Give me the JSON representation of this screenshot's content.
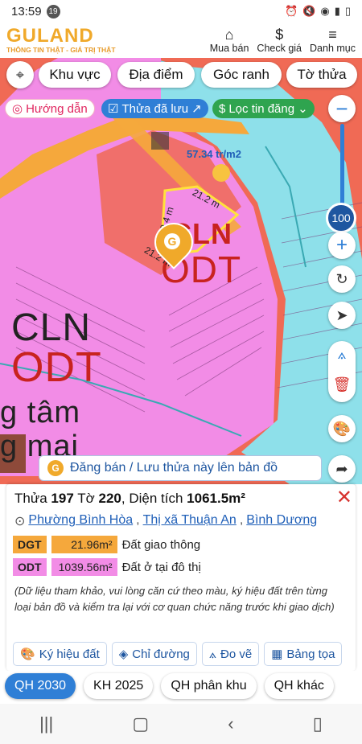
{
  "status": {
    "time": "13:59",
    "badge": "19",
    "icons": [
      "alarm-icon",
      "mute-icon",
      "wifi-icon",
      "signal-icon",
      "battery-icon"
    ]
  },
  "header": {
    "logo": "GULAND",
    "tagline": "THÔNG TIN THẬT - GIÁ TRỊ THẬT",
    "actions": [
      {
        "label": "Mua bán"
      },
      {
        "label": "Check giá"
      },
      {
        "label": "Danh mục"
      }
    ]
  },
  "filters": {
    "khu_vuc": "Khu vực",
    "dia_diem": "Địa điểm",
    "goc_ranh": "Góc ranh",
    "to_thua": "Tờ thửa"
  },
  "pills": {
    "huong_dan": "Hướng dẫn",
    "thua_da_luu": "Thửa đã lưu",
    "loc_tin": "Lọc tin đăng"
  },
  "map": {
    "price": "57.34 tr/m2",
    "dims": [
      "21.2 m",
      "50.4 m",
      "21.2 m"
    ],
    "labels": [
      {
        "t1": "CLN",
        "t2": "ODT"
      },
      {
        "t1": "CLN",
        "t2": "ODT"
      }
    ],
    "street_text": [
      "g tâm",
      "g mại"
    ],
    "zoom": "100",
    "colors": {
      "bg": "#f06a55",
      "pink": "#f28ce6",
      "road": "#f5a83c",
      "water": "#8ee0ea"
    }
  },
  "banner": {
    "text": "Đăng bán / Lưu thửa này lên bản đồ"
  },
  "parcel": {
    "thua_label": "Thửa",
    "thua": "197",
    "to_label": "Tờ",
    "to": "220",
    "area_label": "Diện tích",
    "area": "1061.5m²",
    "ward": "Phường Bình Hòa",
    "district": "Thị xã Thuận An",
    "province": "Bình Dương",
    "land": [
      {
        "code": "DGT",
        "area": "21.96m²",
        "name": "Đất giao thông",
        "color": "#f5a83c"
      },
      {
        "code": "ODT",
        "area": "1039.56m²",
        "name": "Đất ở tại đô thị",
        "color": "#f28ce6"
      }
    ],
    "note": "(Dữ liệu tham khảo, vui lòng căn cứ theo màu, ký hiệu đất trên từng loại bản đồ và kiểm tra lại với cơ quan chức năng trước khi giao dịch)"
  },
  "tools": [
    "Ký hiệu đất",
    "Chỉ đường",
    "Đo vẽ",
    "Bảng tọa"
  ],
  "plan_tabs": [
    {
      "label": "QH 2030"
    },
    {
      "label": "KH 2025"
    },
    {
      "label": "QH phân khu"
    },
    {
      "label": "QH khác"
    }
  ]
}
